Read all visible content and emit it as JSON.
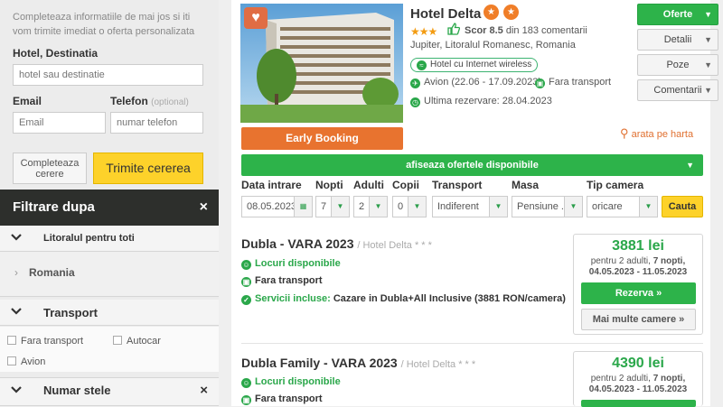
{
  "form": {
    "intro": "Completeaza informatiile de mai jos si iti vom trimite imediat o oferta personalizata",
    "hotel_label": "Hotel, Destinatia",
    "hotel_placeholder": "hotel sau destinatie",
    "email_label": "Email",
    "email_placeholder": "Email",
    "phone_label": "Telefon",
    "phone_optional": "(optional)",
    "phone_placeholder": "numar telefon",
    "complete_button": "Completeaza cerere",
    "send_button": "Trimite cererea"
  },
  "filter": {
    "header": "Filtrare dupa",
    "close_icon": "×",
    "litoral": "Litoralul pentru toti",
    "romania": "Romania",
    "transport_title": "Transport",
    "transport_options": [
      "Fara transport",
      "Autocar",
      "Avion"
    ],
    "stele_title": "Numar stele"
  },
  "hotel": {
    "name": "Hotel Delta",
    "stars": "★★★",
    "score_label": "Scor 8.5",
    "comments": "din 183 comentarii",
    "location": "Jupiter, Litoralul Romanesc, Romania",
    "wifi": "Hotel cu Internet wireless",
    "flight": "Avion (22.06 - 17.09.2023)",
    "no_transport": "Fara transport",
    "last_booking": "Ultima rezervare: 28.04.2023",
    "early_booking": "Early Booking",
    "map_link": "arata pe harta"
  },
  "side_buttons": [
    "Oferte",
    "Detalii",
    "Poze",
    "Comentarii"
  ],
  "search": {
    "show_offers": "afiseaza ofertele disponibile",
    "labels": {
      "date": "Data intrare",
      "nights": "Nopti",
      "adults": "Adulti",
      "kids": "Copii",
      "transport": "Transport",
      "meal": "Masa",
      "room": "Tip camera"
    },
    "values": {
      "date": "08.05.2023",
      "nights": "7",
      "adults": "2",
      "kids": "0",
      "transport": "Indiferent",
      "meal": "Pensiune ...",
      "room": "oricare"
    },
    "search_button": "Cauta"
  },
  "offers": [
    {
      "title": "Dubla - VARA 2023",
      "hotel_sub": "/ Hotel Delta * * *",
      "availability": "Locuri disponibile",
      "transport": "Fara transport",
      "services_label": "Servicii incluse:",
      "services": "Cazare in Dubla+All Inclusive (3881 RON/camera)",
      "price": "3881 lei",
      "price_line1": "pentru 2 adulti, ",
      "nights_text": "7 nopti,",
      "dates": "04.05.2023 - 11.05.2023",
      "reserve": "Rezerva »",
      "more_rooms": "Mai multe camere »"
    },
    {
      "title": "Dubla Family - VARA 2023",
      "hotel_sub": "/ Hotel Delta * * *",
      "availability": "Locuri disponibile",
      "transport": "Fara transport",
      "price": "4390 lei",
      "price_line1": "pentru 2 adulti, ",
      "nights_text": "7 nopti,",
      "dates": "04.05.2023 - 11.05.2023"
    }
  ]
}
